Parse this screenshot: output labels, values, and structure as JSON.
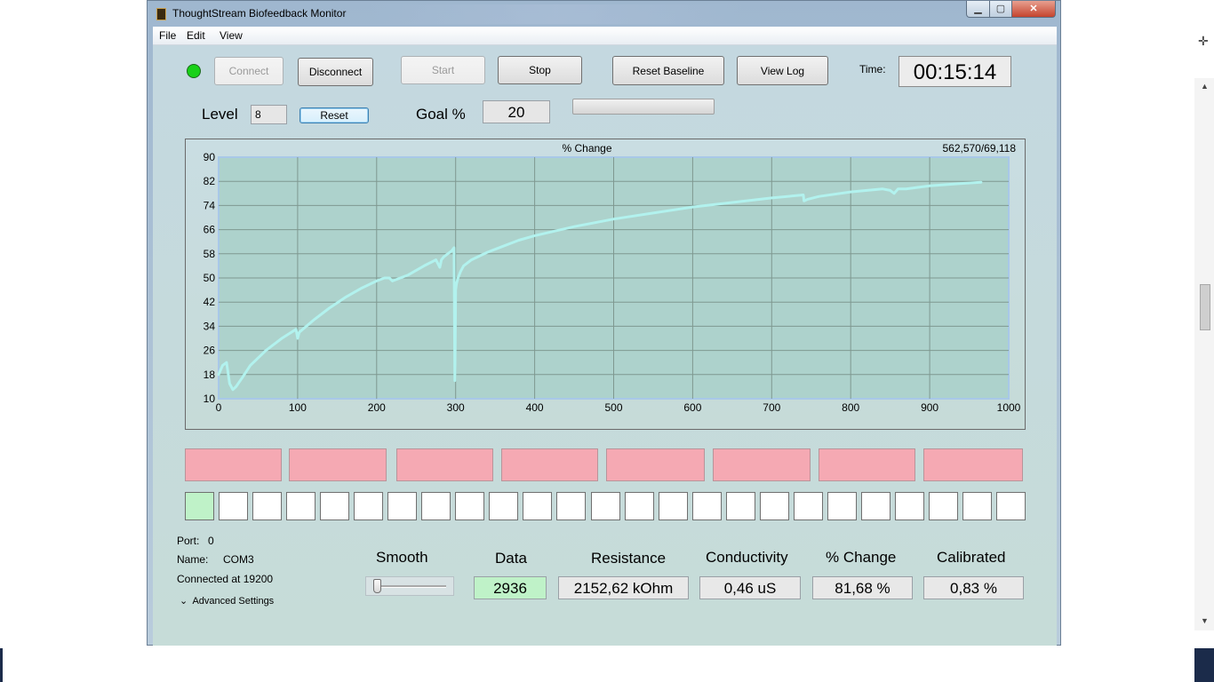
{
  "window": {
    "title": "ThoughtStream Biofeedback Monitor",
    "min_glyph": "▁",
    "max_glyph": "▢",
    "close_glyph": "✕"
  },
  "menu": [
    "File",
    "Edit",
    "View"
  ],
  "toolbar": {
    "connect": "Connect",
    "disconnect": "Disconnect",
    "start": "Start",
    "stop": "Stop",
    "reset_baseline": "Reset Baseline",
    "view_log": "View Log",
    "time_label": "Time:",
    "time_value": "00:15:14",
    "status_color": "#19d119"
  },
  "level": {
    "label": "Level",
    "value": "8",
    "reset": "Reset"
  },
  "goal": {
    "label": "Goal %",
    "value": "20",
    "progress": 0
  },
  "chart_data": {
    "type": "line",
    "title": "% Change",
    "corner_text": "562,570/69,118",
    "xlim": [
      0,
      1000
    ],
    "ylim": [
      10,
      90
    ],
    "x_ticks": [
      0,
      100,
      200,
      300,
      400,
      500,
      600,
      700,
      800,
      900,
      1000
    ],
    "y_ticks": [
      90,
      82,
      74,
      66,
      58,
      50,
      42,
      34,
      26,
      18,
      10
    ],
    "grid": true,
    "line_color": "#b2f2ee",
    "plot_bg": "#add2cc",
    "series": [
      {
        "x": [
          0,
          5,
          10,
          14,
          18,
          22,
          30,
          40,
          60,
          80,
          98,
          100,
          102,
          120,
          140,
          160,
          180,
          200,
          210,
          216,
          220,
          240,
          260,
          275,
          280,
          282,
          285,
          290,
          295,
          298,
          299,
          299.5,
          300,
          301,
          303,
          306,
          310,
          320,
          340,
          360,
          380,
          400,
          450,
          500,
          550,
          600,
          650,
          700,
          740,
          741,
          745,
          760,
          800,
          840,
          850,
          855,
          860,
          870,
          900,
          940,
          965
        ],
        "y": [
          18,
          21,
          22,
          15,
          13,
          14,
          17,
          21,
          26,
          30,
          33,
          30,
          32,
          36,
          40,
          43.5,
          46.5,
          49,
          50,
          50,
          49,
          51,
          54,
          56,
          53.5,
          56,
          57,
          58,
          59,
          60,
          16,
          30,
          46,
          48,
          50,
          52,
          54,
          56,
          58.5,
          60.5,
          62.5,
          64,
          67,
          69.5,
          71.5,
          73.5,
          75,
          76.5,
          77.5,
          75.5,
          76,
          77,
          78.5,
          79.5,
          79,
          78,
          79.5,
          79.5,
          80.5,
          81.3,
          81.7
        ]
      }
    ]
  },
  "indicator_bars": 8,
  "cells": {
    "count": 25,
    "active": 1
  },
  "port": {
    "port_label": "Port:",
    "port_value": "0",
    "name_label": "Name:",
    "name_value": "COM3",
    "connected": "Connected at 19200",
    "advanced_glyph": "⌄",
    "advanced": "Advanced Settings"
  },
  "readouts": {
    "smooth": "Smooth",
    "smooth_value": 0,
    "data_label": "Data",
    "data_value": "2936",
    "data_color": "#bff2c8",
    "resistance_label": "Resistance",
    "resistance_value": "2152,62 kOhm",
    "conductivity_label": "Conductivity",
    "conductivity_value": "0,46 uS",
    "change_label": "% Change",
    "change_value": "81,68 %",
    "calibrated_label": "Calibrated",
    "calibrated_value": "0,83 %"
  },
  "scroll": {
    "up_glyph": "▲",
    "down_glyph": "▼",
    "cross_glyph": "✛"
  }
}
